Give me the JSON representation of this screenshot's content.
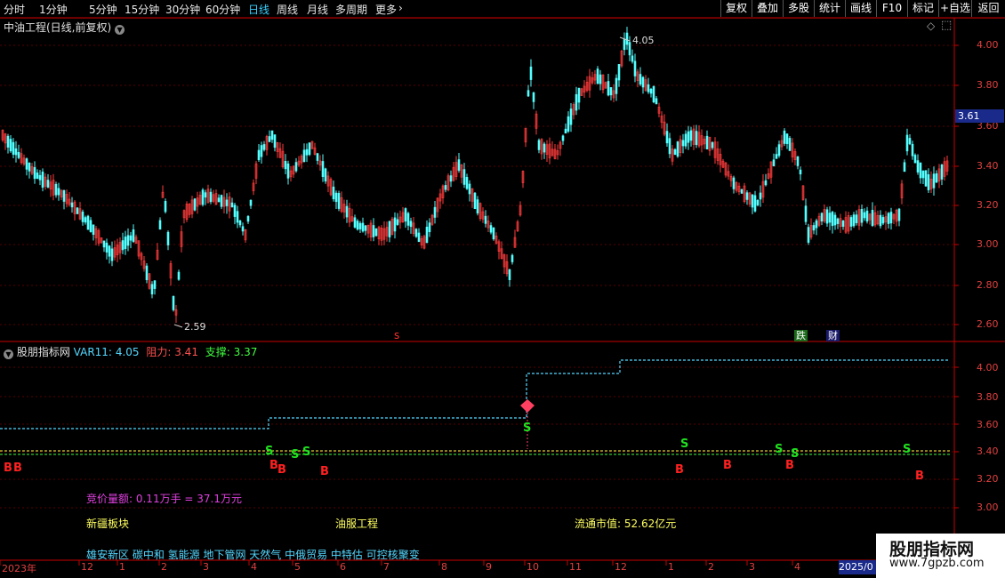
{
  "toolbar": {
    "periods": [
      "分时",
      "1分钟",
      "5分钟",
      "15分钟",
      "30分钟",
      "60分钟",
      "日线",
      "周线",
      "月线",
      "多周期",
      "更多"
    ],
    "active_period": "日线",
    "right_buttons": [
      "复权",
      "叠加",
      "多股",
      "统计",
      "画线",
      "F10",
      "标记",
      "+自选",
      "返回"
    ]
  },
  "main": {
    "title": "中油工程(日线,前复权)",
    "y_ticks": [
      "4.00",
      "3.80",
      "3.60",
      "3.40",
      "3.20",
      "3.00",
      "2.80",
      "2.60"
    ],
    "current_price": "3.61",
    "high_label": "4.05",
    "low_label": "2.59",
    "markers": {
      "s": "s",
      "die": "跌",
      "cai": "财"
    }
  },
  "indicator": {
    "name": "股朋指标网",
    "var11_label": "VAR11:",
    "var11_value": "4.05",
    "resist_label": "阻力:",
    "resist_value": "3.41",
    "support_label": "支撑:",
    "support_value": "3.37",
    "y_ticks": [
      "4.00",
      "3.80",
      "3.60",
      "3.40",
      "3.20",
      "3.00"
    ],
    "b_label": "B",
    "s_label": "S"
  },
  "info": {
    "auction": "竞价量额: 0.11万手 = 37.1万元",
    "sector1": "新疆板块",
    "sector2": "油服工程",
    "market_cap": "流通市值: 52.62亿元",
    "concepts": "雄安新区 碳中和 氢能源 地下管网 天然气 中俄贸易 中特估 可控核聚变"
  },
  "dates": [
    "2023年",
    "12",
    "1",
    "2",
    "3",
    "4",
    "5",
    "6",
    "7",
    "8",
    "9",
    "10",
    "11",
    "12",
    "1",
    "2",
    "3",
    "4"
  ],
  "date_current": "2025/0",
  "watermark": {
    "line1": "股朋指标网",
    "line2": "www.7gpzb.com"
  },
  "colors": {
    "up": "#ff3c3c",
    "down": "#54ffff",
    "axis": "#c80000",
    "buy": "#ff2020",
    "sell": "#20e020",
    "resist": "#ffff40",
    "support": "#40ff40",
    "dash": "#54d8ff"
  }
}
